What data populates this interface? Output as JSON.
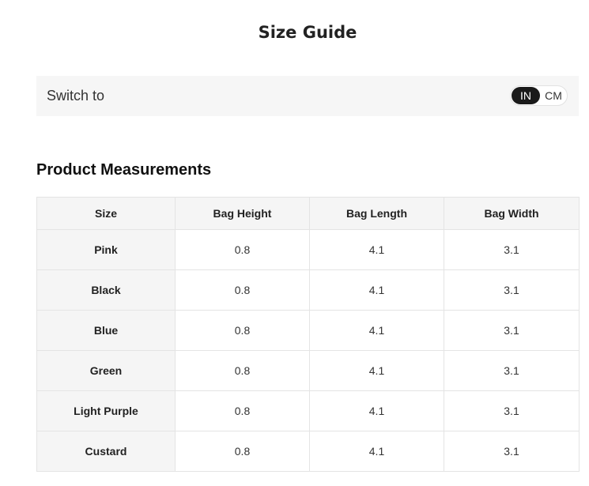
{
  "page": {
    "title": "Size Guide"
  },
  "switch": {
    "label": "Switch to",
    "options": [
      "IN",
      "CM"
    ],
    "selected": "IN"
  },
  "section": {
    "title": "Product Measurements"
  },
  "table": {
    "headers": [
      "Size",
      "Bag Height",
      "Bag Length",
      "Bag Width"
    ],
    "rows": [
      [
        "Pink",
        "0.8",
        "4.1",
        "3.1"
      ],
      [
        "Black",
        "0.8",
        "4.1",
        "3.1"
      ],
      [
        "Blue",
        "0.8",
        "4.1",
        "3.1"
      ],
      [
        "Green",
        "0.8",
        "4.1",
        "3.1"
      ],
      [
        "Light Purple",
        "0.8",
        "4.1",
        "3.1"
      ],
      [
        "Custard",
        "0.8",
        "4.1",
        "3.1"
      ]
    ]
  },
  "colors": {
    "toggle_active_bg": "#1a1a1a",
    "header_bg": "#f5f5f5",
    "bar_bg": "#f6f6f6"
  }
}
